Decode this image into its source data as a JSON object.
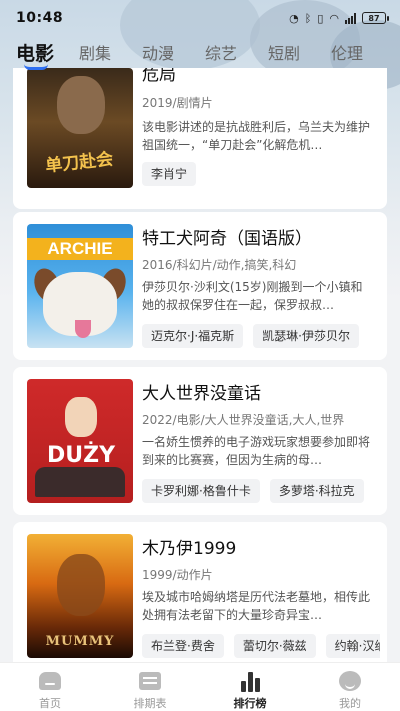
{
  "status": {
    "time": "10:48",
    "battery": "87"
  },
  "tabs": [
    {
      "label": "电影",
      "active": true
    },
    {
      "label": "剧集"
    },
    {
      "label": "动漫"
    },
    {
      "label": "综艺"
    },
    {
      "label": "短剧"
    },
    {
      "label": "伦理"
    }
  ],
  "movies": [
    {
      "title": "危局",
      "meta": "2019/剧情片",
      "desc": "该电影讲述的是抗战胜利后，乌兰夫为维护祖国统一，“单刀赴会”化解危机…",
      "poster_text": "单刀赴会",
      "actors": [
        "李肖宁"
      ]
    },
    {
      "title": "特工犬阿奇（国语版）",
      "meta": "2016/科幻片/动作,搞笑,科幻",
      "desc": "伊莎贝尔·沙利文(15岁)刚搬到一个小镇和她的叔叔保罗住在一起，保罗叔叔…",
      "poster_text": "ARCHIE",
      "actors": [
        "迈克尔·J·福克斯",
        "凯瑟琳·伊莎贝尔"
      ]
    },
    {
      "title": "大人世界没童话",
      "meta": "2022/电影/大人世界没童话,大人,世界",
      "desc": "一名娇生惯养的电子游戏玩家想要参加即将到来的比赛赛，但因为生病的母…",
      "poster_text": "DUŻY",
      "actors": [
        "卡罗利娜·格鲁什卡",
        "多萝塔·科拉克"
      ]
    },
    {
      "title": "木乃伊1999",
      "meta": "1999/动作片",
      "desc": "埃及城市哈姆纳塔是历代法老墓地，相传此处拥有法老留下的大量珍奇异宝…",
      "poster_text": "MUMMY",
      "actors": [
        "布兰登·费舍",
        "蕾切尔·薇兹",
        "约翰·汉纳"
      ]
    }
  ],
  "bottom_nav": [
    {
      "label": "首页",
      "icon": "home-icon"
    },
    {
      "label": "排期表",
      "icon": "calendar-icon"
    },
    {
      "label": "排行榜",
      "icon": "ranking-icon",
      "active": true
    },
    {
      "label": "我的",
      "icon": "profile-icon"
    }
  ]
}
